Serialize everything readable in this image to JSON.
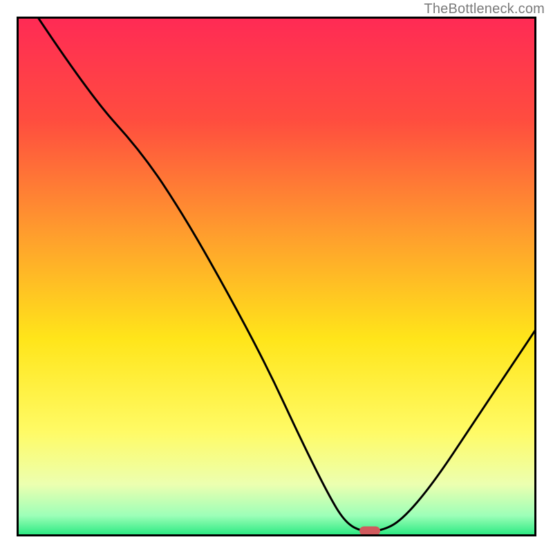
{
  "watermark": "TheBottleneck.com",
  "colors": {
    "gradient_stops": [
      {
        "pct": 0,
        "color": "#ff2a55"
      },
      {
        "pct": 20,
        "color": "#ff4d3f"
      },
      {
        "pct": 42,
        "color": "#ff9e2d"
      },
      {
        "pct": 62,
        "color": "#ffe51a"
      },
      {
        "pct": 80,
        "color": "#fffb66"
      },
      {
        "pct": 90,
        "color": "#ecffb0"
      },
      {
        "pct": 96,
        "color": "#9dffb8"
      },
      {
        "pct": 100,
        "color": "#22e87d"
      }
    ],
    "curve": "#000000",
    "marker": "#d05a5d",
    "border": "#000000"
  },
  "chart_data": {
    "type": "line",
    "title": "",
    "xlabel": "",
    "ylabel": "",
    "xlim": [
      0,
      100
    ],
    "ylim": [
      0,
      100
    ],
    "curve_points": [
      {
        "x": 4,
        "y": 100
      },
      {
        "x": 14,
        "y": 85
      },
      {
        "x": 24,
        "y": 74
      },
      {
        "x": 32,
        "y": 62
      },
      {
        "x": 40,
        "y": 48
      },
      {
        "x": 48,
        "y": 33
      },
      {
        "x": 55,
        "y": 18
      },
      {
        "x": 60,
        "y": 8
      },
      {
        "x": 63,
        "y": 3
      },
      {
        "x": 66,
        "y": 1
      },
      {
        "x": 70,
        "y": 1
      },
      {
        "x": 74,
        "y": 3
      },
      {
        "x": 80,
        "y": 10
      },
      {
        "x": 88,
        "y": 22
      },
      {
        "x": 96,
        "y": 34
      },
      {
        "x": 100,
        "y": 40
      }
    ],
    "marker": {
      "x": 68,
      "y": 1
    },
    "grid": false,
    "legend": false
  }
}
